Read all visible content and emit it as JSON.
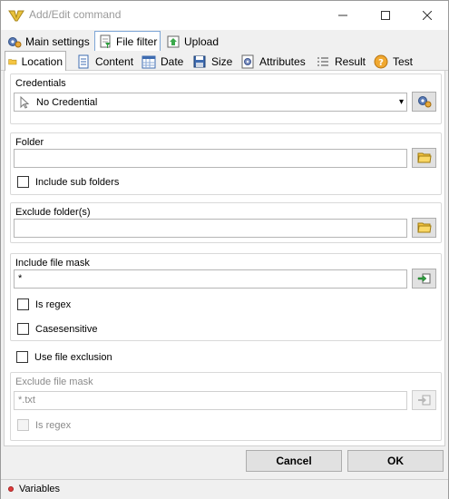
{
  "window": {
    "title": "Add/Edit command",
    "minimize_glyph": "—",
    "maximize_glyph": "☐",
    "close_glyph": "✕"
  },
  "main_tabs": [
    {
      "label": "Main settings",
      "icon": "gear-icon"
    },
    {
      "label": "File filter",
      "icon": "file-filter-icon"
    },
    {
      "label": "Upload",
      "icon": "upload-icon"
    }
  ],
  "sub_tabs": [
    {
      "label": "Location",
      "icon": "folder-icon"
    },
    {
      "label": "Content",
      "icon": "document-icon"
    },
    {
      "label": "Date",
      "icon": "calendar-icon"
    },
    {
      "label": "Size",
      "icon": "disk-icon"
    },
    {
      "label": "Attributes",
      "icon": "attributes-icon"
    },
    {
      "label": "Result",
      "icon": "list-icon"
    },
    {
      "label": "Test",
      "icon": "help-icon"
    }
  ],
  "credentials": {
    "label": "Credentials",
    "selected": "No Credential",
    "dropdown_glyph": "▾"
  },
  "folder": {
    "label": "Folder",
    "value": "",
    "include_subfolders_label": "Include sub folders"
  },
  "exclude_folders": {
    "label": "Exclude folder(s)",
    "value": ""
  },
  "include_mask": {
    "label": "Include file mask",
    "value": "*",
    "is_regex_label": "Is regex",
    "case_sensitive_label": "Casesensitive"
  },
  "use_exclusion_label": "Use file exclusion",
  "exclude_mask": {
    "label": "Exclude file mask",
    "value": "*.txt",
    "is_regex_label": "Is regex"
  },
  "footer": {
    "cancel_label": "Cancel",
    "ok_label": "OK"
  },
  "status": {
    "variables_label": "Variables"
  },
  "colors": {
    "accent_tab_border": "#7ea6d6",
    "folder_yellow": "#f5c542",
    "status_red": "#e03b3b"
  }
}
